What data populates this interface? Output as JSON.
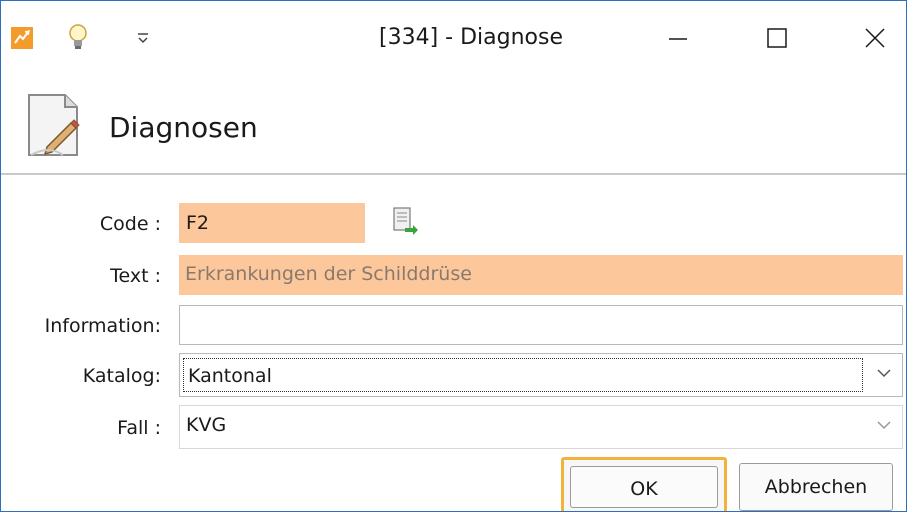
{
  "window": {
    "title": "[334] - Diagnose",
    "title_icons": [
      "app-logo-icon",
      "lightbulb-icon",
      "quick-access-dropdown-icon"
    ],
    "controls": [
      "minimize-icon",
      "maximize-icon",
      "close-icon"
    ]
  },
  "header": {
    "icon": "document-edit-icon",
    "title": "Diagnosen"
  },
  "form": {
    "code": {
      "label": "Code :",
      "value": "F2"
    },
    "text": {
      "label": "Text :",
      "value": "Erkrankungen der Schilddrüse"
    },
    "information": {
      "label": "Information:",
      "value": ""
    },
    "katalog": {
      "label": "Katalog:",
      "value": "Kantonal"
    },
    "fall": {
      "label": "Fall :",
      "value": "KVG"
    }
  },
  "buttons": {
    "ok": "OK",
    "cancel": "Abbrechen"
  },
  "colors": {
    "required_field": "#fcc79a",
    "focus_outline": "#f2b33d",
    "window_border": "#2b6fbd",
    "app_icon": "#f39b2b"
  }
}
